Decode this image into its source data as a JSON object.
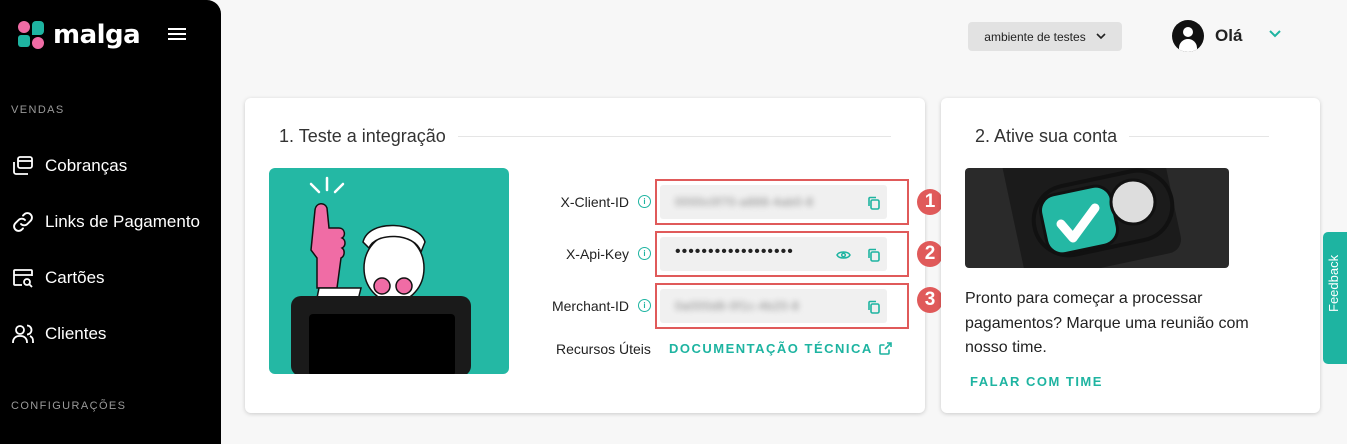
{
  "sidebar": {
    "brand": "malga",
    "sections": {
      "sales": "VENDAS",
      "settings": "CONFIGURAÇÕES"
    },
    "items": [
      {
        "label": "Cobranças",
        "icon": "charges-icon"
      },
      {
        "label": "Links de Pagamento",
        "icon": "link-icon"
      },
      {
        "label": "Cartões",
        "icon": "card-search-icon"
      },
      {
        "label": "Clientes",
        "icon": "users-icon"
      }
    ]
  },
  "header": {
    "environment": "ambiente de testes",
    "greeting": "Olá"
  },
  "integration_card": {
    "title": "1. Teste a integração",
    "credentials": [
      {
        "label": "X-Client-ID",
        "value": "0000c0f70-a888-4ab0-8",
        "masked": false,
        "badge": "1"
      },
      {
        "label": "X-Api-Key",
        "value": "••••••••••••••••••",
        "masked": true,
        "badge": "2"
      },
      {
        "label": "Merchant-ID",
        "value": "0a000d8-0f1c-4b20-8",
        "masked": false,
        "badge": "3"
      }
    ],
    "resources_label": "Recursos Úteis",
    "docs_link": "DOCUMENTAÇÃO TÉCNICA"
  },
  "activate_card": {
    "title": "2. Ative sua conta",
    "description": "Pronto para começar a processar pagamentos? Marque uma reunião com nosso time.",
    "cta": "FALAR COM TIME"
  },
  "feedback_tab": "Feedback",
  "colors": {
    "accent": "#1eb4a1",
    "pink": "#f06ca5",
    "highlight": "#e05a5a",
    "sidebar": "#000000"
  }
}
